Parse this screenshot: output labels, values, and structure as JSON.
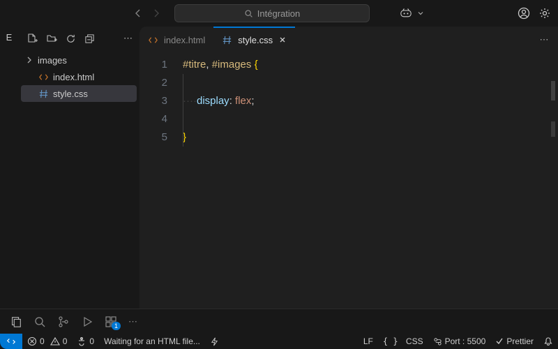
{
  "titlebar": {
    "search_placeholder": "Intégration"
  },
  "sidebar": {
    "explorer_label": "E",
    "items": [
      {
        "name": "images",
        "type": "folder"
      },
      {
        "name": "index.html",
        "type": "html"
      },
      {
        "name": "style.css",
        "type": "css"
      }
    ]
  },
  "tabs": [
    {
      "label": "index.html",
      "active": false
    },
    {
      "label": "style.css",
      "active": true
    }
  ],
  "code": {
    "lines": [
      "1",
      "2",
      "3",
      "4",
      "5"
    ],
    "l1": {
      "sel1": "#titre",
      "comma": ", ",
      "sel2": "#images",
      "sp": " ",
      "brace": "{"
    },
    "l3": {
      "prop": "display",
      "colon": ": ",
      "val": "flex",
      "semi": ";"
    },
    "l5": {
      "brace": "}"
    }
  },
  "panel": {
    "badge": "1"
  },
  "statusbar": {
    "errors": "0",
    "warnings": "0",
    "ports": "0",
    "waiting": "Waiting for an HTML file...",
    "eol": "LF",
    "lang": "CSS",
    "port": "Port : 5500",
    "prettier": "Prettier"
  }
}
